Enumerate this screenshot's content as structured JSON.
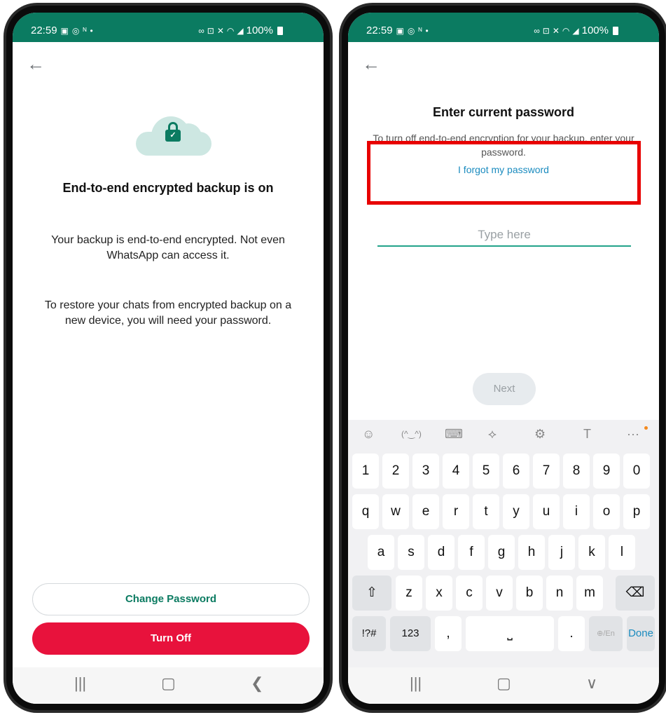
{
  "status_bar": {
    "time": "22:59",
    "left_icons": [
      "gallery-icon",
      "whatsapp-icon",
      "signal-icon"
    ],
    "right_icons": [
      "link-icon",
      "lock-icon",
      "mute-icon",
      "wifi-icon",
      "volte-icon",
      "cell-signal-icon"
    ],
    "battery": "100%"
  },
  "left_screen": {
    "back_icon": "arrow-left-icon",
    "illustration_icon": "cloud-lock-icon",
    "title": "End-to-end encrypted backup is on",
    "paragraph1": "Your backup is end-to-end encrypted. Not even WhatsApp can access it.",
    "paragraph2": "To restore your chats from encrypted backup on a new device, you will need your password.",
    "change_password_label": "Change Password",
    "turn_off_label": "Turn Off"
  },
  "right_screen": {
    "back_icon": "arrow-left-icon",
    "title": "Enter current password",
    "description": "To turn off end-to-end encryption for your backup, enter your password.",
    "forgot_link": "I forgot my password",
    "input_placeholder": "Type here",
    "input_value": "",
    "next_label": "Next"
  },
  "keyboard": {
    "toolbar": [
      "emoji-icon",
      "kaomoji-icon",
      "keyboard-icon",
      "move-cursor-icon",
      "settings-icon",
      "handwriting-icon",
      "more-icon"
    ],
    "number_row": [
      "1",
      "2",
      "3",
      "4",
      "5",
      "6",
      "7",
      "8",
      "9",
      "0"
    ],
    "row1": [
      "q",
      "w",
      "e",
      "r",
      "t",
      "y",
      "u",
      "i",
      "o",
      "p"
    ],
    "row2": [
      "a",
      "s",
      "d",
      "f",
      "g",
      "h",
      "j",
      "k",
      "l"
    ],
    "row3": [
      "z",
      "x",
      "c",
      "v",
      "b",
      "n",
      "m"
    ],
    "symbols_key": "!?#",
    "numbers_key": "123",
    "comma_key": ",",
    "period_key": ".",
    "lang_key": "⊕/En",
    "done_key": "Done"
  },
  "nav_bar_left": {
    "recents": "|||",
    "home": "▢",
    "back": "❮"
  },
  "nav_bar_right": {
    "recents": "|||",
    "home": "▢",
    "back": "∨"
  },
  "colors": {
    "brand_green": "#0b7b61",
    "danger_red": "#e8123c",
    "link_blue": "#1a8bbf",
    "highlight_red": "#e80000",
    "input_underline": "#23a38a"
  }
}
